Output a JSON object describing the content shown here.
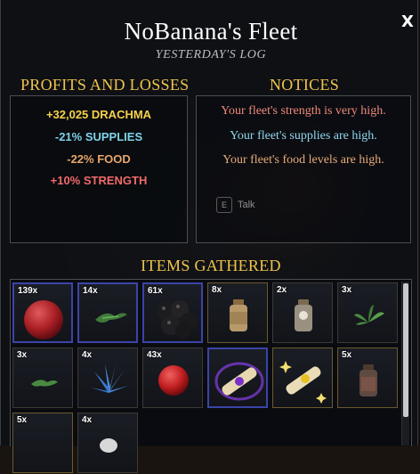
{
  "window": {
    "title": "NoBanana's Fleet",
    "subtitle": "YESTERDAY'S LOG",
    "close_label": "X"
  },
  "profits": {
    "heading": "PROFITS AND LOSSES",
    "lines": [
      {
        "text": "+32,025 DRACHMA",
        "color": "#f7d14a"
      },
      {
        "text": "-21% SUPPLIES",
        "color": "#7fd3e8"
      },
      {
        "text": "-22% FOOD",
        "color": "#e8a56a"
      },
      {
        "text": "+10% STRENGTH",
        "color": "#f06a6a"
      }
    ]
  },
  "notices": {
    "heading": "NOTICES",
    "lines": [
      {
        "text": "Your fleet's strength is very high.",
        "color": "#f08a7a"
      },
      {
        "text": "Your fleet's supplies are high.",
        "color": "#8fd8ee"
      },
      {
        "text": "Your fleet's food levels are high.",
        "color": "#e8ab78"
      }
    ]
  },
  "background_hint": {
    "key": "E",
    "label": "Talk"
  },
  "items": {
    "heading": "ITEMS GATHERED",
    "slots": [
      {
        "qty": "139x",
        "icon": "red-orb-icon",
        "rarity": "blue"
      },
      {
        "qty": "14x",
        "icon": "green-herb-icon",
        "rarity": "blue"
      },
      {
        "qty": "61x",
        "icon": "black-orbs-icon",
        "rarity": "blue"
      },
      {
        "qty": "8x",
        "icon": "jar-icon",
        "rarity": "gold"
      },
      {
        "qty": "2x",
        "icon": "jar-pearl-icon",
        "rarity": "dark"
      },
      {
        "qty": "3x",
        "icon": "green-plant-icon",
        "rarity": "dark"
      },
      {
        "qty": "3x",
        "icon": "green-herb-small-icon",
        "rarity": "dark"
      },
      {
        "qty": "4x",
        "icon": "blue-plant-icon",
        "rarity": "dark"
      },
      {
        "qty": "43x",
        "icon": "red-ball-icon",
        "rarity": "dark"
      },
      {
        "qty": "",
        "icon": "purple-scroll-icon",
        "rarity": "blue"
      },
      {
        "qty": "",
        "icon": "gold-scroll-icon",
        "rarity": "gold"
      },
      {
        "qty": "5x",
        "icon": "dark-jar-icon",
        "rarity": "gold"
      },
      {
        "qty": "5x",
        "icon": "item-icon",
        "rarity": "gold"
      },
      {
        "qty": "4x",
        "icon": "item-icon",
        "rarity": "dark"
      }
    ]
  }
}
